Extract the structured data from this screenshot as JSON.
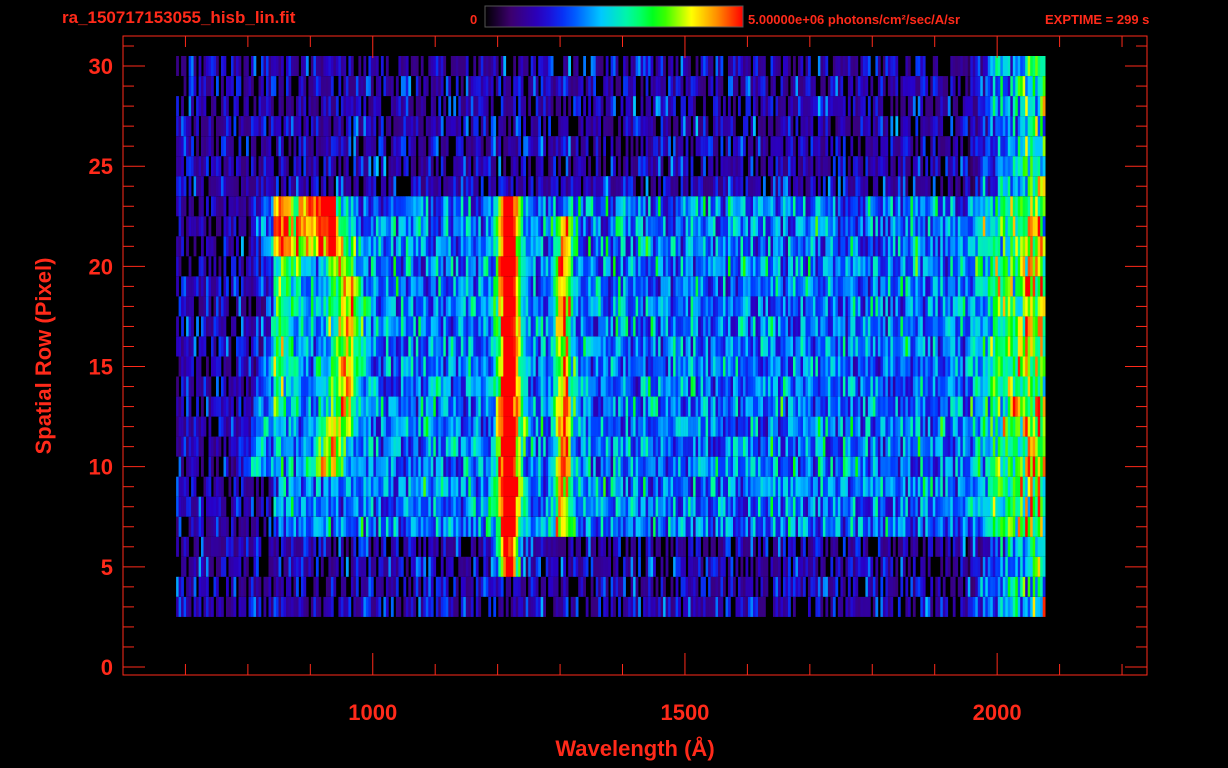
{
  "header": {
    "filename": "ra_150717153055_hisb_lin.fit",
    "colorbar_min": "0",
    "colorbar_max": "5.00000e+06 photons/cm²/sec/A/sr",
    "exptime": "EXPTIME = 299 s"
  },
  "colors": {
    "axis": "#ff2a1a",
    "background": "#000000"
  },
  "chart_data": {
    "type": "heatmap",
    "title": "ra_150717153055_hisb_lin.fit",
    "xlabel": "Wavelength (Å)",
    "ylabel": "Spatial Row (Pixel)",
    "xlim": [
      600,
      2240
    ],
    "ylim": [
      -0.4,
      31.5
    ],
    "xticks": [
      1000,
      1500,
      2000
    ],
    "yticks": [
      0,
      5,
      10,
      15,
      20,
      25,
      30
    ],
    "colorbar": {
      "min": 0,
      "max": 5000000,
      "unit": "photons/cm²/sec/A/sr",
      "colormap": "rainbow"
    },
    "detector_extent": {
      "x": [
        685,
        2075
      ],
      "rows": [
        3,
        30
      ]
    },
    "features": [
      {
        "name": "continuum",
        "x_range": [
          685,
          2075
        ],
        "rows": [
          3,
          30
        ],
        "level": 0.25
      },
      {
        "name": "bright band",
        "x_range": [
          840,
          2070
        ],
        "rows": [
          7,
          23
        ],
        "level": 0.4
      },
      {
        "name": "emission line",
        "x": 1216,
        "rows": [
          5,
          23
        ],
        "level": 0.9
      },
      {
        "name": "emission line",
        "x": 1304,
        "rows": [
          7,
          22
        ],
        "level": 0.5
      },
      {
        "name": "arc feature",
        "x_range": [
          830,
          985
        ],
        "rows": [
          10,
          23
        ],
        "level": 0.65
      },
      {
        "name": "red edge",
        "x_range": [
          1945,
          2075
        ],
        "rows": [
          2,
          30
        ],
        "level": 0.7
      }
    ]
  }
}
